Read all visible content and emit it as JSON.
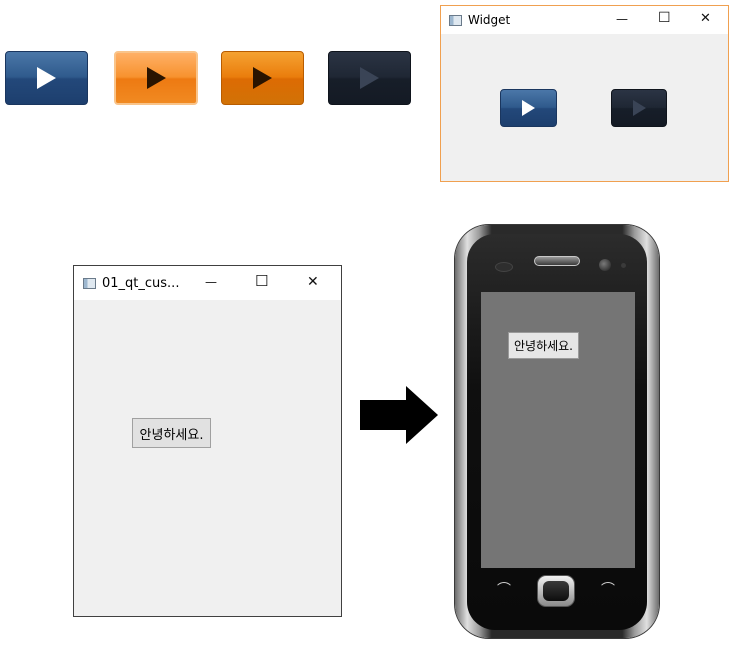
{
  "play_buttons": [
    {
      "name": "play-button-blue",
      "style": "btn-blue",
      "triangle_color": "#ffffff"
    },
    {
      "name": "play-button-orange-light",
      "style": "btn-orange-light",
      "triangle_color": "#2a1400"
    },
    {
      "name": "play-button-orange-dark",
      "style": "btn-orange-dark",
      "triangle_color": "#2a1400"
    },
    {
      "name": "play-button-disabled",
      "style": "btn-navy",
      "triangle_color": "#3a4456"
    }
  ],
  "widget_window": {
    "title": "Widget",
    "border_color": "#f0a050",
    "controls": {
      "minimize": "—",
      "maximize": "☐",
      "close": "✕"
    }
  },
  "qt_window": {
    "title": "01_qt_cus...",
    "border_color": "#404040",
    "controls": {
      "minimize": "—",
      "maximize": "☐",
      "close": "✕"
    },
    "button_label": "안녕하세요."
  },
  "phone": {
    "screen_color": "#757575",
    "button_label": "안녕하세요.",
    "call_icon": "phone-call-icon",
    "end_icon": "phone-end-icon"
  },
  "colors": {
    "window_bg": "#f0f0f0",
    "arrow": "#000000"
  }
}
